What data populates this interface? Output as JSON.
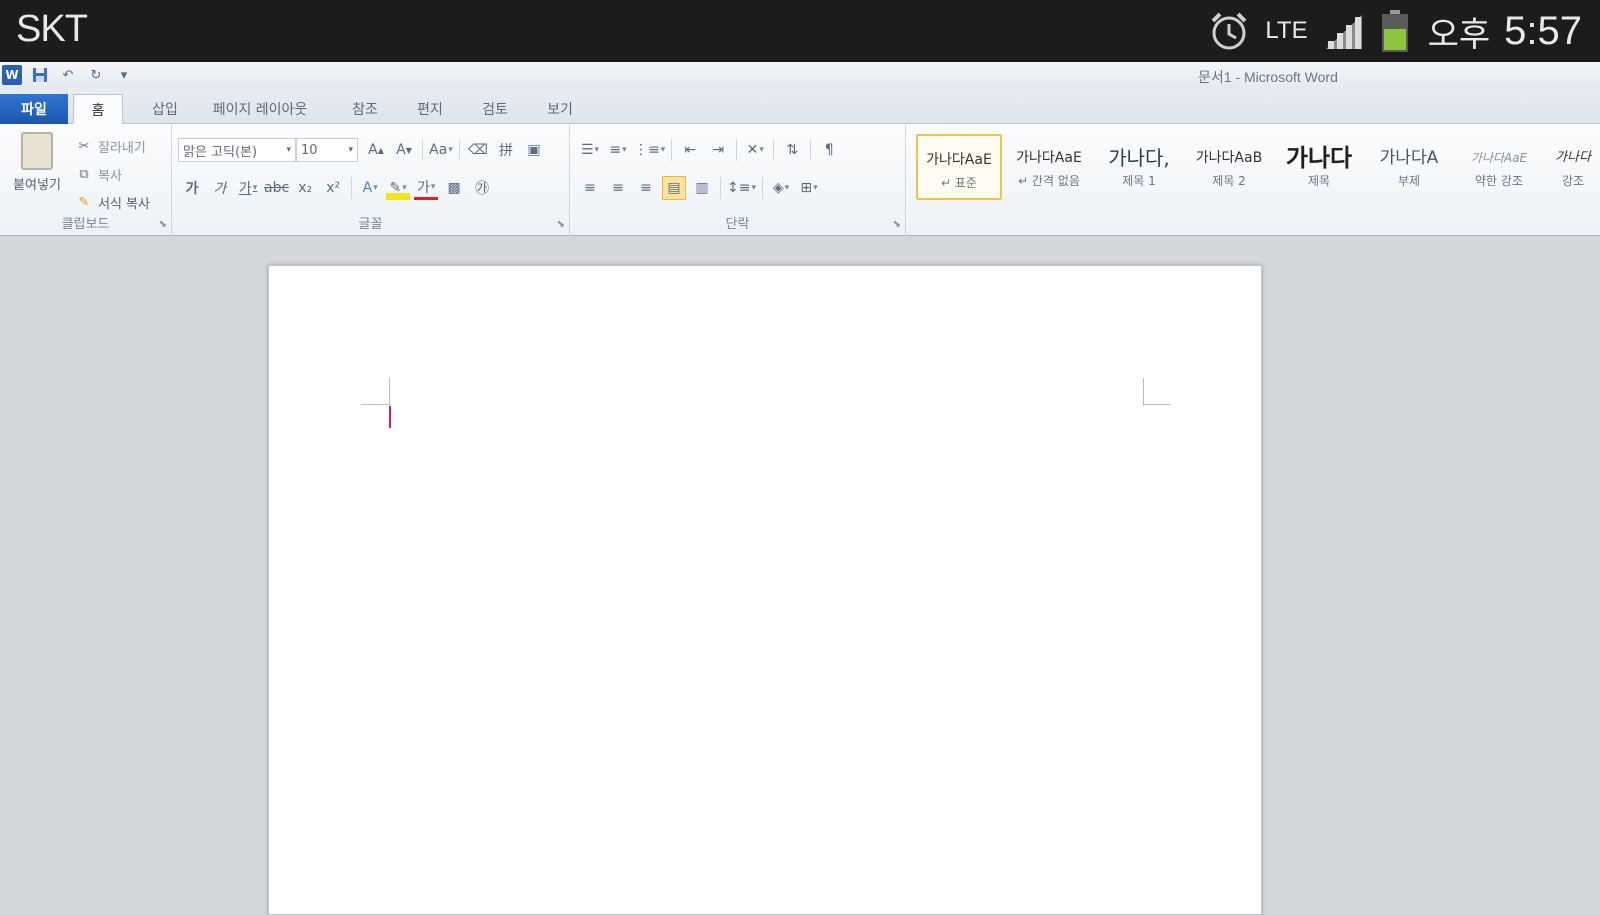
{
  "status_bar": {
    "carrier": "SKT",
    "network": "LTE",
    "ampm": "오후",
    "time": "5:57"
  },
  "window": {
    "title": "문서1 - Microsoft Word",
    "qat": [
      "word-logo",
      "save-icon",
      "undo-icon",
      "redo-icon",
      "customize-icon"
    ]
  },
  "tabs": [
    "파일",
    "홈",
    "삽입",
    "페이지 레이아웃",
    "참조",
    "편지",
    "검토",
    "보기"
  ],
  "ribbon": {
    "clipboard": {
      "label": "클립보드",
      "paste": "붙여넣기",
      "cut": "잘라내기",
      "copy": "복사",
      "format_painter": "서식 복사"
    },
    "font": {
      "label": "글꼴",
      "font_name": "맑은 고딕(본)",
      "font_size": "10"
    },
    "paragraph": {
      "label": "단락"
    },
    "styles": [
      {
        "sample": "가나다AaE",
        "name": "↵ 표준"
      },
      {
        "sample": "가나다AaE",
        "name": "↵ 간격 없음"
      },
      {
        "sample": "가나다,",
        "name": "제목 1"
      },
      {
        "sample": "가나다AaB",
        "name": "제목 2"
      },
      {
        "sample": "가나다",
        "name": "제목"
      },
      {
        "sample": "가나다A",
        "name": "부제"
      },
      {
        "sample": "가나다AaE",
        "name": "약한 강조"
      },
      {
        "sample": "가나다",
        "name": "강조"
      }
    ]
  },
  "colors": {
    "status_bg": "#1c1c1c",
    "file_tab": "#2b68c4",
    "style_selected": "#f3c24d",
    "caret": "#c2207a",
    "battery": "#8cc63f"
  }
}
